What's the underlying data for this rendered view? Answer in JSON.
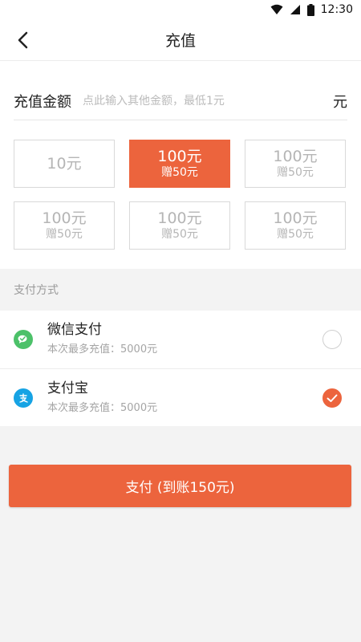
{
  "status_bar": {
    "time": "12:30"
  },
  "nav": {
    "title": "充值"
  },
  "amount": {
    "label": "充值金额",
    "placeholder": "点此输入其他金额，最低1元",
    "unit": "元"
  },
  "options": [
    {
      "main": "10元",
      "sub": "",
      "selected": false
    },
    {
      "main": "100元",
      "sub": "赠50元",
      "selected": true
    },
    {
      "main": "100元",
      "sub": "赠50元",
      "selected": false
    },
    {
      "main": "100元",
      "sub": "赠50元",
      "selected": false
    },
    {
      "main": "100元",
      "sub": "赠50元",
      "selected": false
    },
    {
      "main": "100元",
      "sub": "赠50元",
      "selected": false
    }
  ],
  "payment": {
    "section_label": "支付方式",
    "methods": [
      {
        "name": "微信支付",
        "limit": "本次最多充值：5000元",
        "icon": "wechat-icon",
        "checked": false
      },
      {
        "name": "支付宝",
        "limit": "本次最多充值：5000元",
        "icon": "alipay-icon",
        "checked": true
      }
    ]
  },
  "pay_button": {
    "label": "支付 (到账150元)"
  },
  "colors": {
    "accent": "#ec643d",
    "wechat": "#4cc169",
    "alipay": "#16a3e4"
  }
}
